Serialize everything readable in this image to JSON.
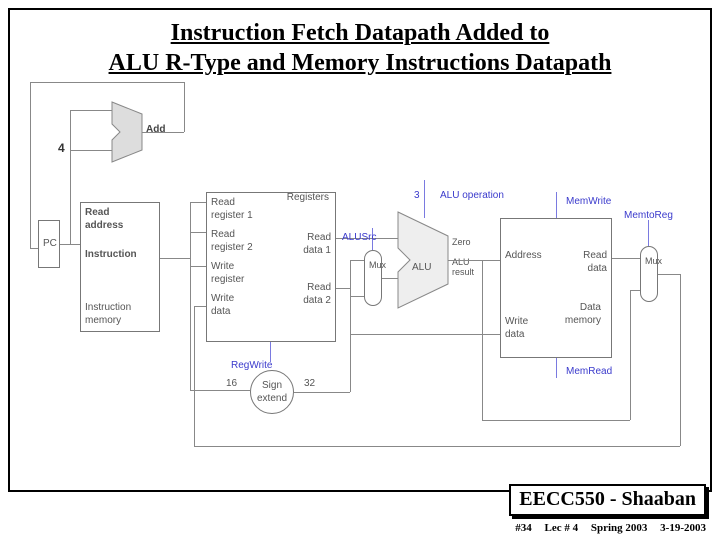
{
  "title": {
    "line1": "Instruction Fetch Datapath Added to",
    "line2": "ALU R-Type and Memory Instructions Datapath"
  },
  "blocks": {
    "pc": "PC",
    "instr_mem_port": "Read\naddress",
    "instr_mem_bus": "Instruction",
    "instr_mem_name": "Instruction\nmemory",
    "add": "Add",
    "const4": "4",
    "registers": {
      "header": "Registers",
      "read_reg1": "Read\nregister 1",
      "read_reg2": "Read\nregister 2",
      "write_reg": "Write\nregister",
      "write_data": "Write\ndata",
      "read_data1": "Read\ndata 1",
      "read_data2": "Read\ndata 2"
    },
    "sign_extend": "Sign\nextend",
    "mux": "Mux",
    "alu": {
      "name": "ALU",
      "zero": "Zero",
      "result": "ALU\nresult"
    },
    "data_mem": {
      "name": "Data\nmemory",
      "address": "Address",
      "write_data": "Write\ndata",
      "read_data": "Read\ndata"
    }
  },
  "signals": {
    "alu_operation": "ALU operation",
    "alu_op_width": "3",
    "alusrc": "ALUSrc",
    "regwrite": "RegWrite",
    "memwrite": "MemWrite",
    "memread": "MemRead",
    "memtoreg": "MemtoReg"
  },
  "widths": {
    "sign_in": "16",
    "sign_out": "32"
  },
  "footer": {
    "course": "EECC550 - Shaaban",
    "slide": "#34",
    "lecture": "Lec # 4",
    "term": "Spring 2003",
    "date": "3-19-2003"
  }
}
